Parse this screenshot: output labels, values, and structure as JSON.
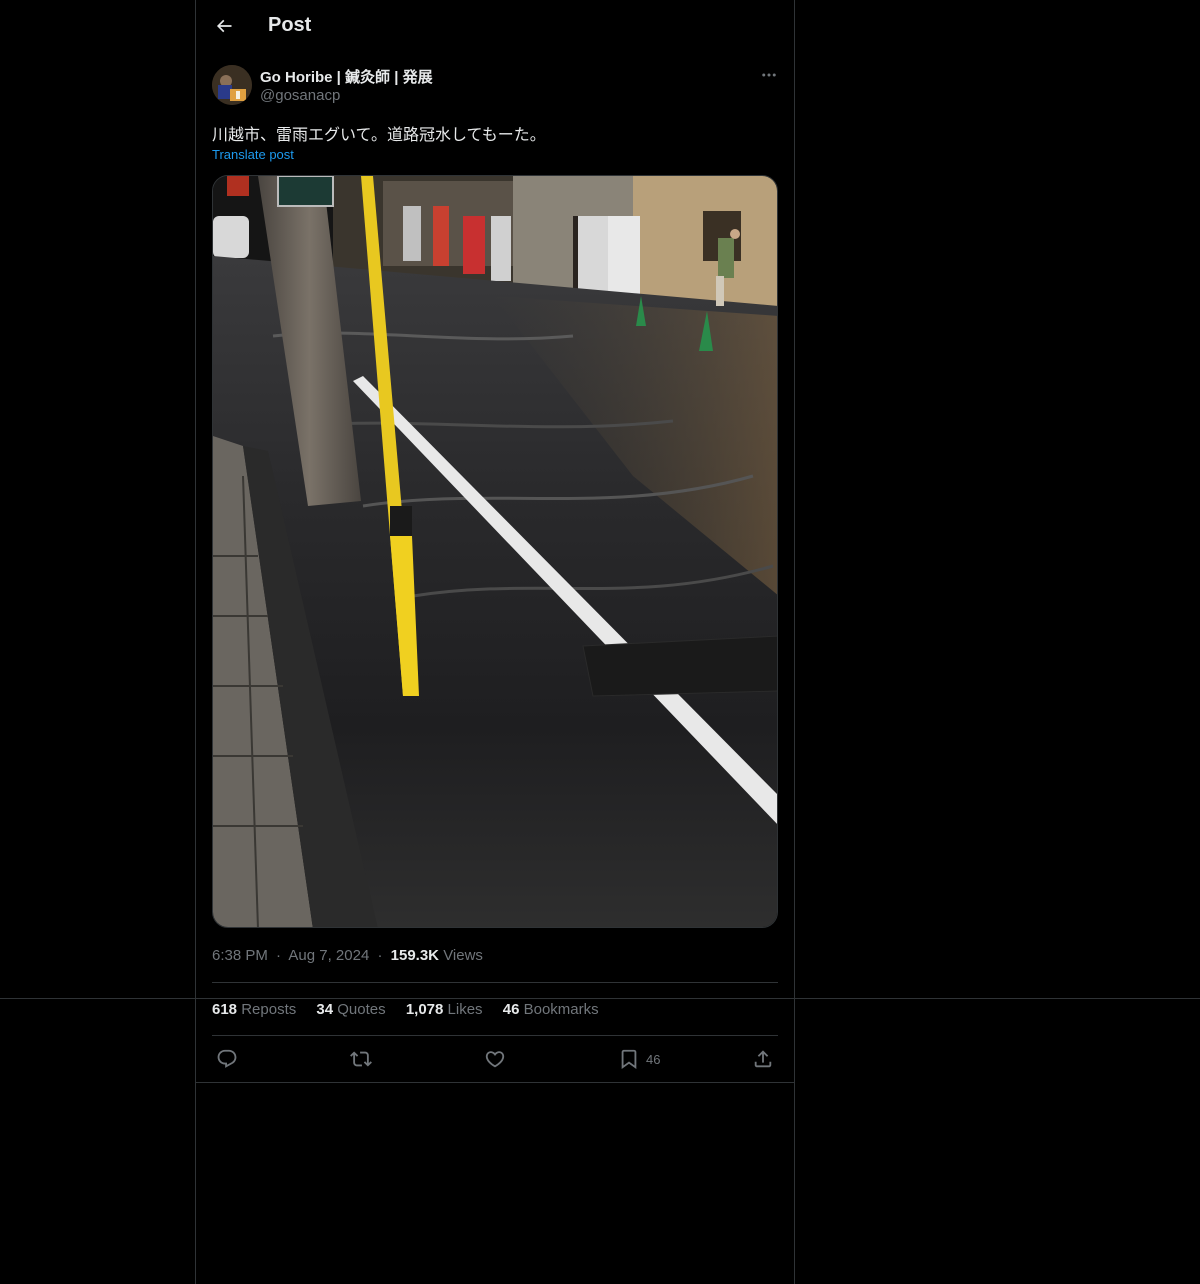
{
  "header": {
    "title": "Post"
  },
  "post": {
    "author_name": "Go Horibe | 鍼灸師 | 発展",
    "author_handle": "@gosanacp",
    "text": "川越市、雷雨エグいて。道路冠水してもーた。",
    "translate_label": "Translate post",
    "time": "6:38 PM",
    "date": "Aug 7, 2024",
    "separator": "·",
    "views_count": "159.3K",
    "views_label": "Views"
  },
  "stats": {
    "reposts_count": "618",
    "reposts_label": "Reposts",
    "quotes_count": "34",
    "quotes_label": "Quotes",
    "likes_count": "1,078",
    "likes_label": "Likes",
    "bookmarks_count": "46",
    "bookmarks_label": "Bookmarks"
  },
  "actions": {
    "bookmark_count": "46"
  },
  "icons": {
    "back": "arrow-left-icon",
    "more": "more-horizontal-icon",
    "reply": "reply-icon",
    "repost": "repost-icon",
    "like": "heart-icon",
    "bookmark": "bookmark-icon",
    "share": "share-icon"
  },
  "colors": {
    "background": "#000000",
    "text": "#e7e9ea",
    "muted": "#71767b",
    "link": "#1d9bf0",
    "border": "#2f3336"
  }
}
